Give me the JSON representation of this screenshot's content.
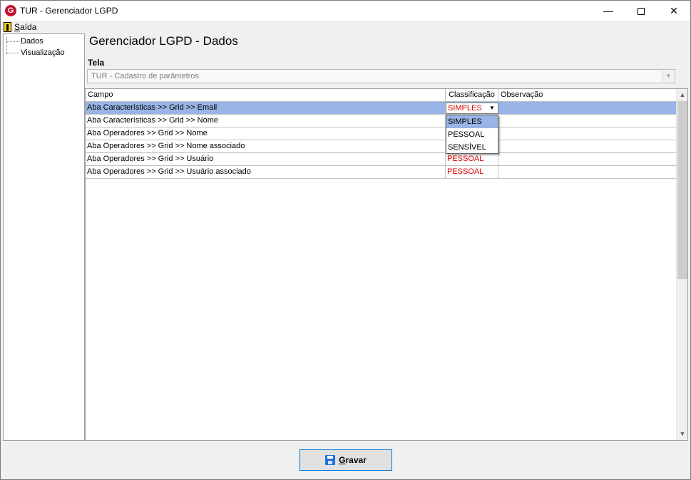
{
  "window": {
    "title": "TUR - Gerenciador LGPD",
    "app_icon_letter": "G",
    "minimize_glyph": "—",
    "close_glyph": "✕"
  },
  "menu": {
    "exit_label_first": "S",
    "exit_label_rest": "aída"
  },
  "tree": {
    "items": [
      "Dados",
      "Visualização"
    ]
  },
  "main": {
    "page_title": "Gerenciador LGPD - Dados",
    "screen_label": "Tela",
    "screen_value": "TUR - Cadastro de parâmetros"
  },
  "grid": {
    "columns": [
      "Campo",
      "Classificação",
      "Observação"
    ],
    "rows": [
      {
        "campo": "Aba Características >> Grid >> Email",
        "classificacao": "SIMPLES",
        "observacao": ""
      },
      {
        "campo": "Aba Características >> Grid >> Nome",
        "classificacao": "",
        "observacao": ""
      },
      {
        "campo": "Aba Operadores >> Grid >> Nome",
        "classificacao": "",
        "observacao": ""
      },
      {
        "campo": "Aba Operadores >> Grid >> Nome associado",
        "classificacao": "",
        "observacao": ""
      },
      {
        "campo": "Aba Operadores >> Grid >> Usuário",
        "classificacao": "PESSOAL",
        "observacao": ""
      },
      {
        "campo": "Aba Operadores >> Grid >> Usuário associado",
        "classificacao": "PESSOAL",
        "observacao": ""
      }
    ],
    "selected_row": 0,
    "editor_value": "SIMPLES",
    "dropdown_options": [
      "SIMPLES",
      "PESSOAL",
      "SENSÍVEL"
    ],
    "dropdown_highlighted": 0
  },
  "footer": {
    "save_first": "G",
    "save_rest": "ravar"
  },
  "colors": {
    "selection": "#99b4e6",
    "classification_text": "#e00000",
    "button_border": "#0078d7",
    "app_icon": "#c4122f"
  }
}
